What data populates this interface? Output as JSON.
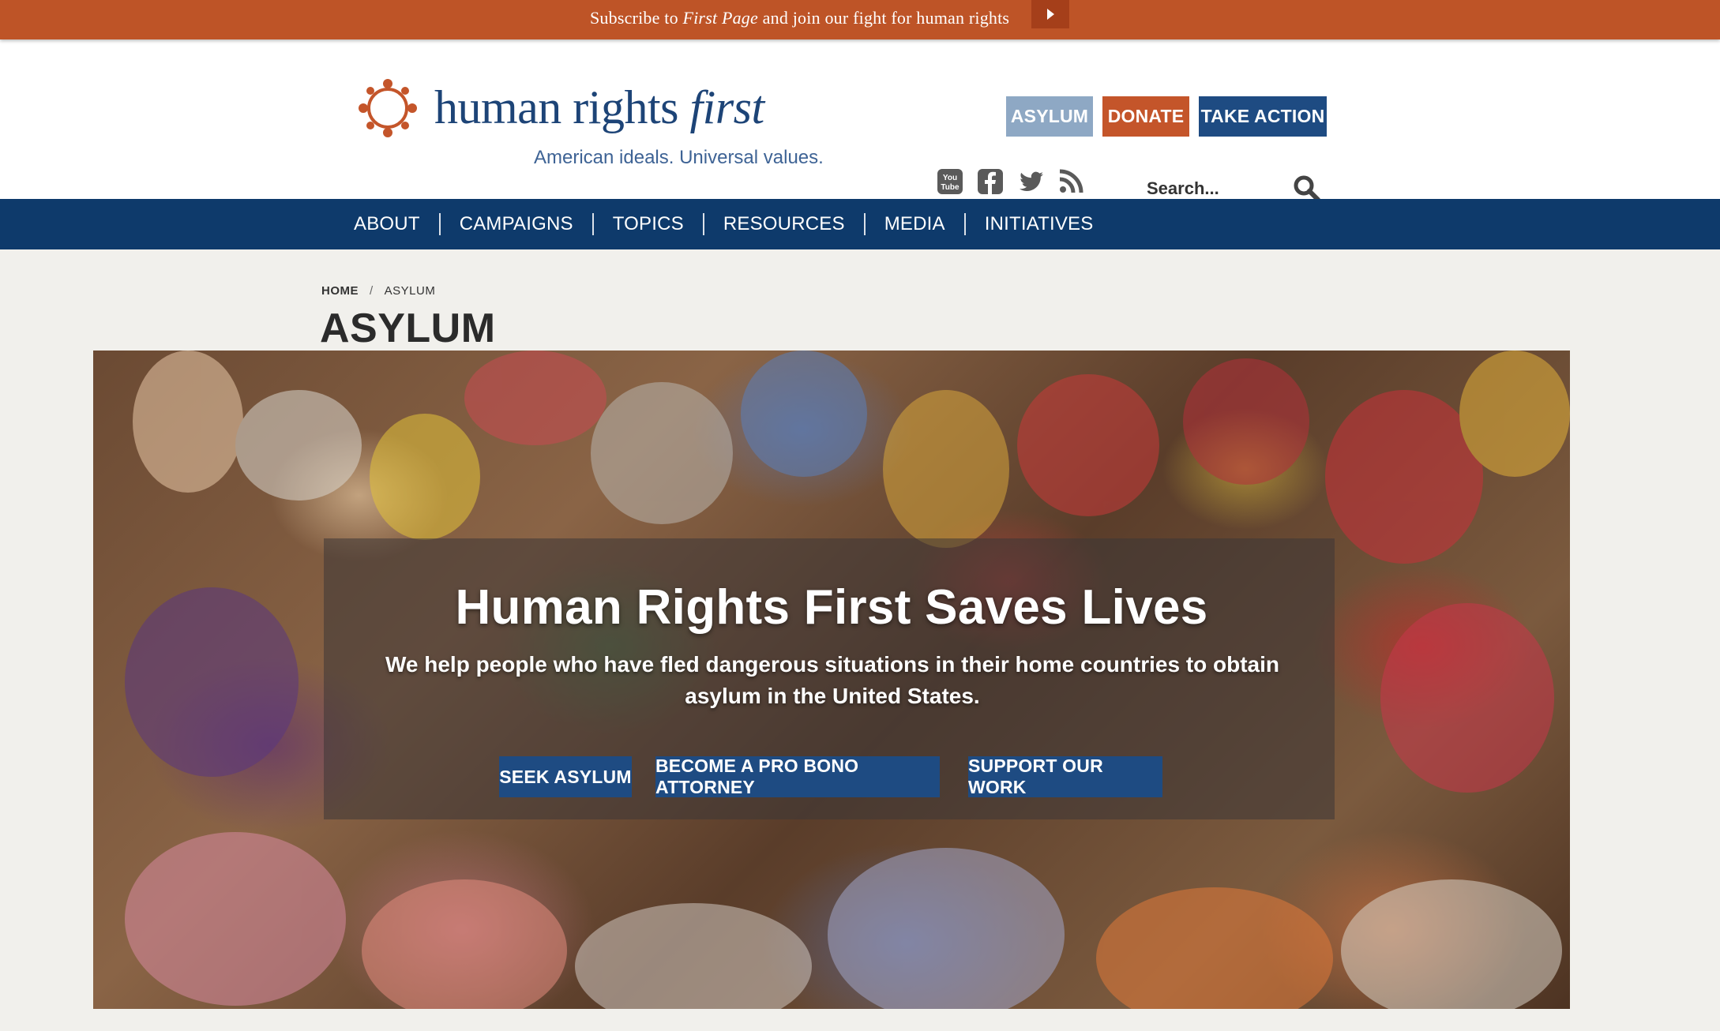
{
  "subscribe": {
    "text_before": "Subscribe to ",
    "text_em": "First Page",
    "text_after": " and join our fight for human rights"
  },
  "header": {
    "logo_word_1": "human rights ",
    "logo_word_2": "first",
    "tagline": "American ideals. Universal values.",
    "buttons": {
      "asylum": "ASYLUM",
      "donate": "DONATE",
      "take_action": "TAKE ACTION"
    },
    "social": [
      "youtube-icon",
      "facebook-icon",
      "twitter-icon",
      "rss-icon"
    ],
    "search_placeholder": "Search..."
  },
  "nav": {
    "items": [
      "ABOUT",
      "CAMPAIGNS",
      "TOPICS",
      "RESOURCES",
      "MEDIA",
      "INITIATIVES"
    ]
  },
  "breadcrumb": {
    "home": "HOME",
    "separator": "/",
    "current": "ASYLUM"
  },
  "page": {
    "title": "ASYLUM"
  },
  "hero": {
    "headline": "Human Rights First Saves Lives",
    "subtext": "We help people who have fled dangerous situations in their home countries to obtain asylum in the United States.",
    "buttons": [
      "SEEK ASYLUM",
      "BECOME A PRO BONO ATTORNEY",
      "SUPPORT OUR WORK"
    ]
  },
  "colors": {
    "subscribe_bar": "#be5427",
    "nav": "#0e3a6b",
    "primary_button": "#1e4b82",
    "donate": "#c4552a",
    "asylum_button": "#8ea8c4",
    "brand_text": "#1d4477"
  }
}
